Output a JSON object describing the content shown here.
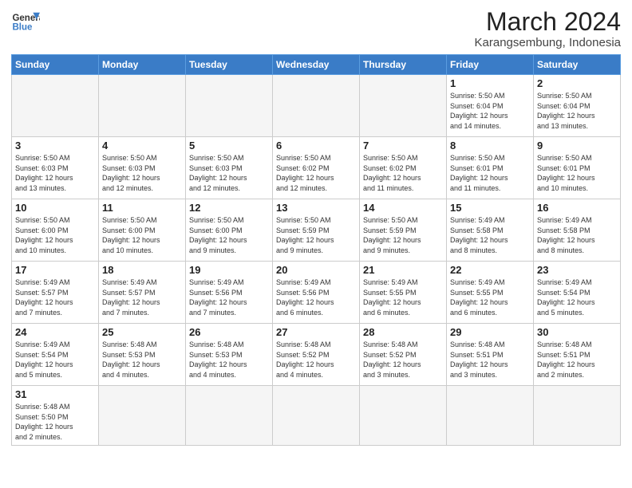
{
  "header": {
    "logo_line1": "General",
    "logo_line2": "Blue",
    "title": "March 2024",
    "subtitle": "Karangsembung, Indonesia"
  },
  "weekdays": [
    "Sunday",
    "Monday",
    "Tuesday",
    "Wednesday",
    "Thursday",
    "Friday",
    "Saturday"
  ],
  "weeks": [
    [
      {
        "day": "",
        "info": ""
      },
      {
        "day": "",
        "info": ""
      },
      {
        "day": "",
        "info": ""
      },
      {
        "day": "",
        "info": ""
      },
      {
        "day": "",
        "info": ""
      },
      {
        "day": "1",
        "info": "Sunrise: 5:50 AM\nSunset: 6:04 PM\nDaylight: 12 hours\nand 14 minutes."
      },
      {
        "day": "2",
        "info": "Sunrise: 5:50 AM\nSunset: 6:04 PM\nDaylight: 12 hours\nand 13 minutes."
      }
    ],
    [
      {
        "day": "3",
        "info": "Sunrise: 5:50 AM\nSunset: 6:03 PM\nDaylight: 12 hours\nand 13 minutes."
      },
      {
        "day": "4",
        "info": "Sunrise: 5:50 AM\nSunset: 6:03 PM\nDaylight: 12 hours\nand 12 minutes."
      },
      {
        "day": "5",
        "info": "Sunrise: 5:50 AM\nSunset: 6:03 PM\nDaylight: 12 hours\nand 12 minutes."
      },
      {
        "day": "6",
        "info": "Sunrise: 5:50 AM\nSunset: 6:02 PM\nDaylight: 12 hours\nand 12 minutes."
      },
      {
        "day": "7",
        "info": "Sunrise: 5:50 AM\nSunset: 6:02 PM\nDaylight: 12 hours\nand 11 minutes."
      },
      {
        "day": "8",
        "info": "Sunrise: 5:50 AM\nSunset: 6:01 PM\nDaylight: 12 hours\nand 11 minutes."
      },
      {
        "day": "9",
        "info": "Sunrise: 5:50 AM\nSunset: 6:01 PM\nDaylight: 12 hours\nand 10 minutes."
      }
    ],
    [
      {
        "day": "10",
        "info": "Sunrise: 5:50 AM\nSunset: 6:00 PM\nDaylight: 12 hours\nand 10 minutes."
      },
      {
        "day": "11",
        "info": "Sunrise: 5:50 AM\nSunset: 6:00 PM\nDaylight: 12 hours\nand 10 minutes."
      },
      {
        "day": "12",
        "info": "Sunrise: 5:50 AM\nSunset: 6:00 PM\nDaylight: 12 hours\nand 9 minutes."
      },
      {
        "day": "13",
        "info": "Sunrise: 5:50 AM\nSunset: 5:59 PM\nDaylight: 12 hours\nand 9 minutes."
      },
      {
        "day": "14",
        "info": "Sunrise: 5:50 AM\nSunset: 5:59 PM\nDaylight: 12 hours\nand 9 minutes."
      },
      {
        "day": "15",
        "info": "Sunrise: 5:49 AM\nSunset: 5:58 PM\nDaylight: 12 hours\nand 8 minutes."
      },
      {
        "day": "16",
        "info": "Sunrise: 5:49 AM\nSunset: 5:58 PM\nDaylight: 12 hours\nand 8 minutes."
      }
    ],
    [
      {
        "day": "17",
        "info": "Sunrise: 5:49 AM\nSunset: 5:57 PM\nDaylight: 12 hours\nand 7 minutes."
      },
      {
        "day": "18",
        "info": "Sunrise: 5:49 AM\nSunset: 5:57 PM\nDaylight: 12 hours\nand 7 minutes."
      },
      {
        "day": "19",
        "info": "Sunrise: 5:49 AM\nSunset: 5:56 PM\nDaylight: 12 hours\nand 7 minutes."
      },
      {
        "day": "20",
        "info": "Sunrise: 5:49 AM\nSunset: 5:56 PM\nDaylight: 12 hours\nand 6 minutes."
      },
      {
        "day": "21",
        "info": "Sunrise: 5:49 AM\nSunset: 5:55 PM\nDaylight: 12 hours\nand 6 minutes."
      },
      {
        "day": "22",
        "info": "Sunrise: 5:49 AM\nSunset: 5:55 PM\nDaylight: 12 hours\nand 6 minutes."
      },
      {
        "day": "23",
        "info": "Sunrise: 5:49 AM\nSunset: 5:54 PM\nDaylight: 12 hours\nand 5 minutes."
      }
    ],
    [
      {
        "day": "24",
        "info": "Sunrise: 5:49 AM\nSunset: 5:54 PM\nDaylight: 12 hours\nand 5 minutes."
      },
      {
        "day": "25",
        "info": "Sunrise: 5:48 AM\nSunset: 5:53 PM\nDaylight: 12 hours\nand 4 minutes."
      },
      {
        "day": "26",
        "info": "Sunrise: 5:48 AM\nSunset: 5:53 PM\nDaylight: 12 hours\nand 4 minutes."
      },
      {
        "day": "27",
        "info": "Sunrise: 5:48 AM\nSunset: 5:52 PM\nDaylight: 12 hours\nand 4 minutes."
      },
      {
        "day": "28",
        "info": "Sunrise: 5:48 AM\nSunset: 5:52 PM\nDaylight: 12 hours\nand 3 minutes."
      },
      {
        "day": "29",
        "info": "Sunrise: 5:48 AM\nSunset: 5:51 PM\nDaylight: 12 hours\nand 3 minutes."
      },
      {
        "day": "30",
        "info": "Sunrise: 5:48 AM\nSunset: 5:51 PM\nDaylight: 12 hours\nand 2 minutes."
      }
    ],
    [
      {
        "day": "31",
        "info": "Sunrise: 5:48 AM\nSunset: 5:50 PM\nDaylight: 12 hours\nand 2 minutes."
      },
      {
        "day": "",
        "info": ""
      },
      {
        "day": "",
        "info": ""
      },
      {
        "day": "",
        "info": ""
      },
      {
        "day": "",
        "info": ""
      },
      {
        "day": "",
        "info": ""
      },
      {
        "day": "",
        "info": ""
      }
    ]
  ]
}
